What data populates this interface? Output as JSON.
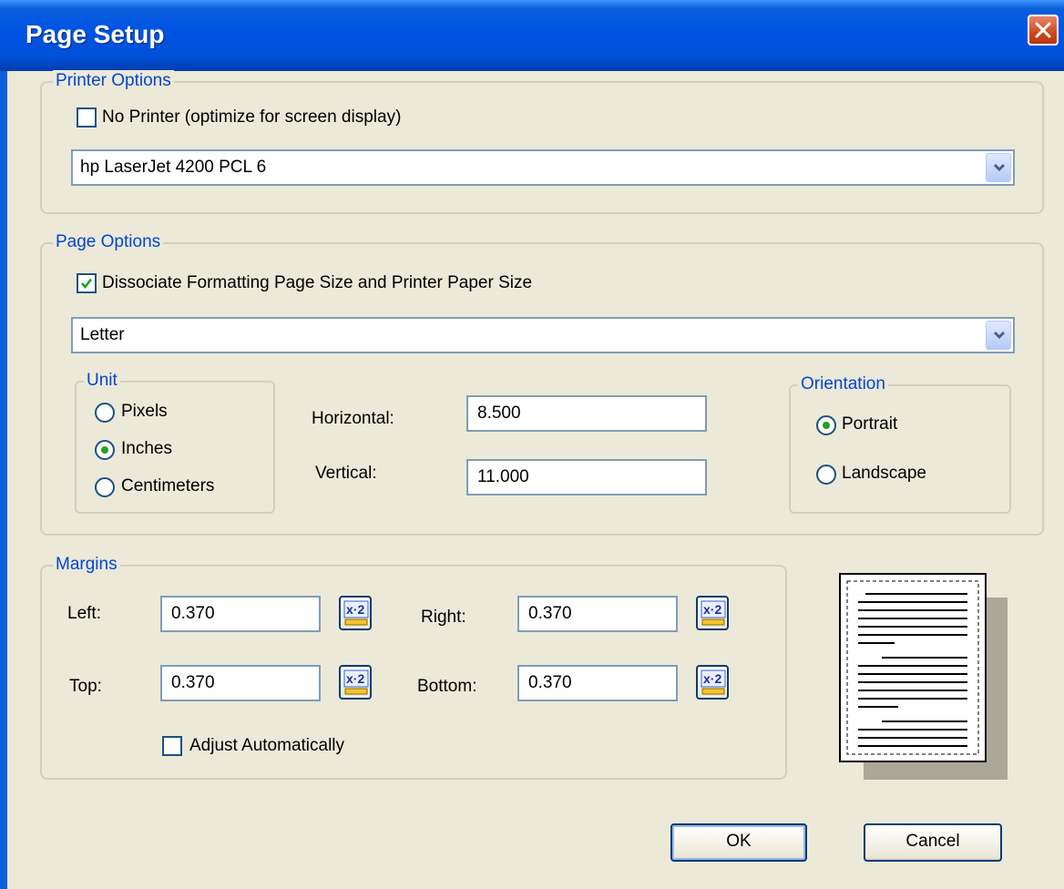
{
  "title": "Page Setup",
  "printer_options": {
    "label": "Printer Options",
    "no_printer_label": "No Printer (optimize for screen display)",
    "no_printer_checked": false,
    "printer_value": "hp LaserJet 4200 PCL 6"
  },
  "page_options": {
    "label": "Page Options",
    "dissociate_label": "Dissociate Formatting Page Size and Printer Paper Size",
    "dissociate_checked": true,
    "paper_value": "Letter",
    "unit": {
      "label": "Unit",
      "options": [
        "Pixels",
        "Inches",
        "Centimeters"
      ],
      "selected": "Inches"
    },
    "horizontal_label": "Horizontal:",
    "horizontal_value": "8.500",
    "vertical_label": "Vertical:",
    "vertical_value": "11.000",
    "orientation": {
      "label": "Orientation",
      "options": [
        "Portrait",
        "Landscape"
      ],
      "selected": "Portrait"
    }
  },
  "margins": {
    "label": "Margins",
    "left_label": "Left:",
    "left_value": "0.370",
    "right_label": "Right:",
    "right_value": "0.370",
    "top_label": "Top:",
    "top_value": "0.370",
    "bottom_label": "Bottom:",
    "bottom_value": "0.370",
    "adjust_label": "Adjust Automatically",
    "adjust_checked": false
  },
  "buttons": {
    "ok": "OK",
    "cancel": "Cancel"
  },
  "colors": {
    "titlebar": "#0055e5",
    "group_label": "#0046d5",
    "dialog_bg": "#ece9d8"
  }
}
